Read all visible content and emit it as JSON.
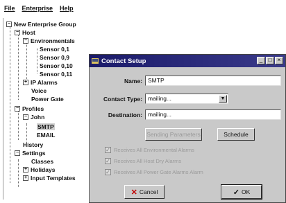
{
  "menu": [
    "File",
    "Enterprise",
    "Help"
  ],
  "tree": {
    "root": "New Enterprise Group",
    "host": "Host",
    "environmentals": "Environmentals",
    "sensors": [
      "Sensor 0,1",
      "Sensor 0,9",
      "Sensor 0,10",
      "Sensor 0,11"
    ],
    "ip_alarms": "IP Alarms",
    "voice": "Voice",
    "power_gate": "Power Gate",
    "profiles": "Profiles",
    "john": "John",
    "smtp": "SMTP",
    "email": "EMAIL",
    "history": "History",
    "settings": "Settings",
    "classes": "Classes",
    "holidays": "Holidays",
    "input_templates": "Input Templates"
  },
  "dialog": {
    "title": "Contact Setup",
    "name_label": "Name:",
    "name_value": "SMTP",
    "contact_type_label": "Contact Type:",
    "contact_type_value": "mailing...",
    "destination_label": "Destination:",
    "destination_value": "mailing...",
    "btn_sending": "Sending Parameters",
    "btn_schedule": "Schedule",
    "checks": [
      "Receives All Environmental Alarms",
      "Receives All Host Dry Alarms",
      "Receives All Power Gate Alarms Alarm"
    ],
    "cancel_label": "Cancel",
    "ok_label": "OK"
  }
}
